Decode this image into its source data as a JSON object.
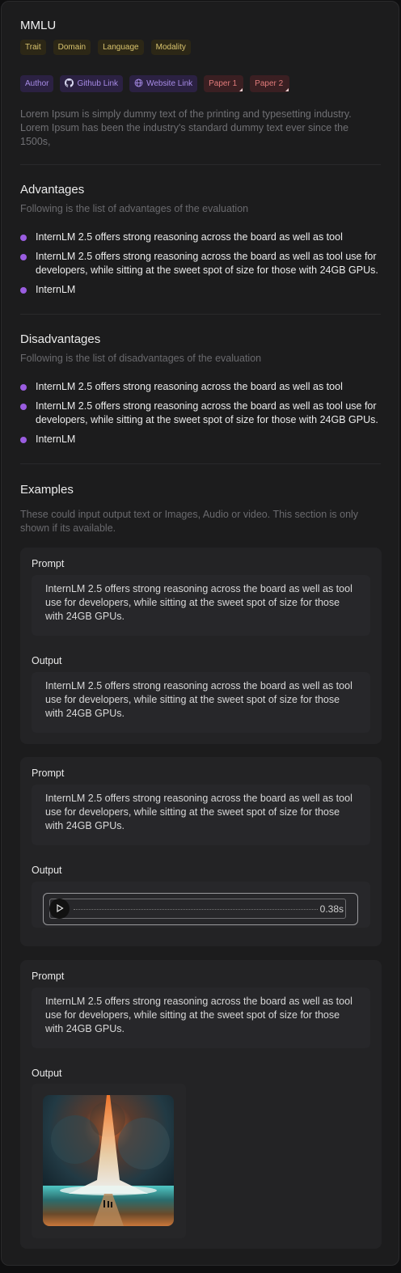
{
  "title": "MMLU",
  "tags": [
    "Trait",
    "Domain",
    "Language",
    "Modality"
  ],
  "links": {
    "author": "Author",
    "github": "Github Link",
    "website": "Website Link",
    "paper1": "Paper 1",
    "paper2": "Paper 2"
  },
  "description": "Lorem Ipsum is simply dummy text of the printing and typesetting industry. Lorem Ipsum has been the industry's standard dummy text ever since the 1500s,",
  "advantages": {
    "title": "Advantages",
    "subtitle": "Following is the list of advantages of the evaluation",
    "items": [
      "InternLM 2.5 offers strong reasoning across the board as well as tool",
      "InternLM 2.5 offers strong reasoning across the board as well as tool use for developers, while sitting at the sweet spot of size for those with 24GB GPUs.",
      "InternLM"
    ]
  },
  "disadvantages": {
    "title": "Disadvantages",
    "subtitle": "Following is the list of disadvantages of the evaluation",
    "items": [
      "InternLM 2.5 offers strong reasoning across the board as well as tool",
      "InternLM 2.5 offers strong reasoning across the board as well as tool use for developers, while sitting at the sweet spot of size for those with 24GB GPUs.",
      "InternLM"
    ]
  },
  "examples": {
    "title": "Examples",
    "subtitle": "These could input output text or Images, Audio or video. This section is only shown if its available.",
    "items": [
      {
        "prompt_label": "Prompt",
        "prompt": "InternLM 2.5 offers strong reasoning across the board as well as tool use for developers, while sitting at the sweet spot of size for those with 24GB GPUs.",
        "output_label": "Output",
        "output_type": "text",
        "output": "InternLM 2.5 offers strong reasoning across the board as well as tool use for developers, while sitting at the sweet spot of size for those with 24GB GPUs."
      },
      {
        "prompt_label": "Prompt",
        "prompt": "InternLM 2.5 offers strong reasoning across the board as well as tool use for developers, while sitting at the sweet spot of size for those with 24GB GPUs.",
        "output_label": "Output",
        "output_type": "audio",
        "audio_time": "0.38s"
      },
      {
        "prompt_label": "Prompt",
        "prompt": "InternLM 2.5 offers strong reasoning across the board as well as tool use for developers, while sitting at the sweet spot of size for those with 24GB GPUs.",
        "output_label": "Output",
        "output_type": "image"
      }
    ]
  },
  "colors": {
    "tag_text": "#d9c46e",
    "accent_purple": "#9a5de0",
    "paper_red": "#e07a7a"
  }
}
